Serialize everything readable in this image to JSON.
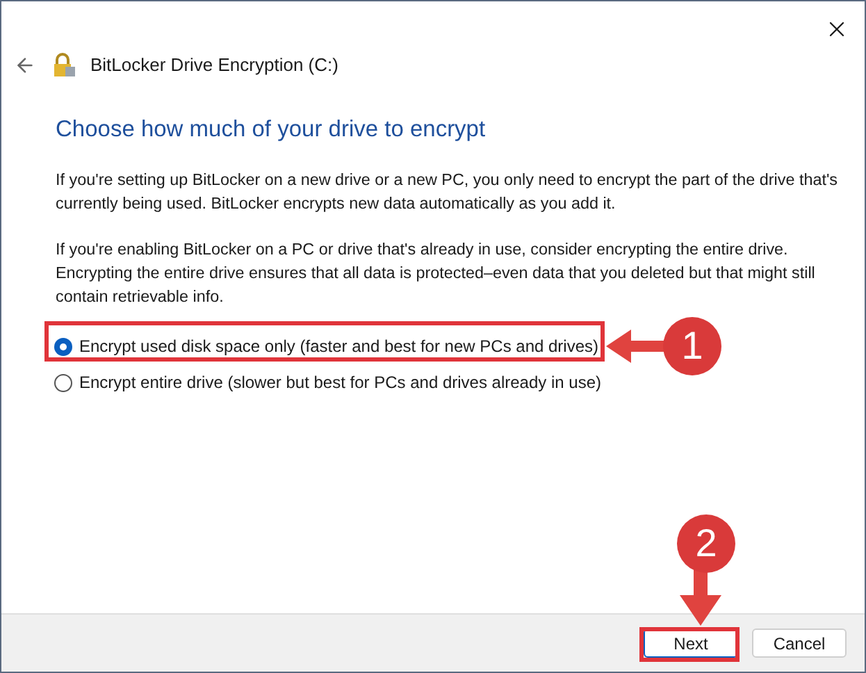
{
  "window": {
    "title": "BitLocker Drive Encryption (C:)"
  },
  "heading": "Choose how much of your drive to encrypt",
  "paragraphs": [
    "If you're setting up BitLocker on a new drive or a new PC, you only need to encrypt the part of the drive that's currently being used. BitLocker encrypts new data automatically as you add it.",
    "If you're enabling BitLocker on a PC or drive that's already in use, consider encrypting the entire drive. Encrypting the entire drive ensures that all data is protected–even data that you deleted but that might still contain retrievable info."
  ],
  "options": [
    {
      "label": "Encrypt used disk space only (faster and best for new PCs and drives)",
      "selected": true
    },
    {
      "label": "Encrypt entire drive (slower but best for PCs and drives already in use)",
      "selected": false
    }
  ],
  "buttons": [
    {
      "label": "Next",
      "kind": "primary"
    },
    {
      "label": "Cancel",
      "kind": "secondary"
    }
  ],
  "annotations": [
    {
      "label": "1",
      "kind": "option"
    },
    {
      "label": "2",
      "kind": "button"
    }
  ]
}
